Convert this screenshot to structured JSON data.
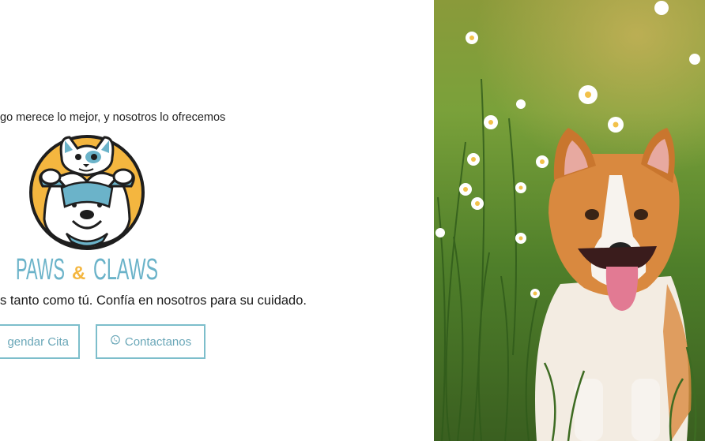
{
  "hero": {
    "tagline": "go merece lo mejor, y nosotros lo ofrecemos",
    "subtitle": "s tanto como tú. Confía en nosotros para su cuidado.",
    "logo": {
      "brand_word_1": "PAWS",
      "brand_amp": "&",
      "brand_word_2": "CLAWS",
      "colors": {
        "blue": "#6bb3c9",
        "orange": "#f4b63f",
        "outline": "#1e1e1e"
      }
    },
    "buttons": {
      "appointment_label": "gendar Cita",
      "contact_label": "Contactanos",
      "contact_icon": "whatsapp-icon"
    }
  },
  "photo": {
    "subject": "corgi-dog-in-flower-field",
    "colors": {
      "grass": "#5e8a2e",
      "fur": "#d9893f",
      "tongue": "#e27a93"
    }
  },
  "theme": {
    "accent": "#7dbecb"
  }
}
